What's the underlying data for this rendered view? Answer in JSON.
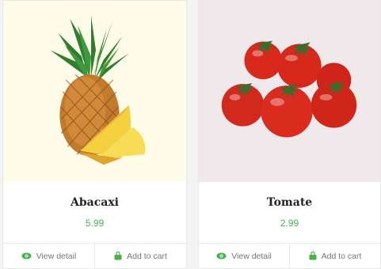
{
  "products": [
    {
      "name": "Abacaxi",
      "price": "5.99",
      "view_label": "View detail",
      "cart_label": "Add to cart",
      "image_icon": "pineapple-image"
    },
    {
      "name": "Tomate",
      "price": "2.99",
      "view_label": "View detail",
      "cart_label": "Add to cart",
      "image_icon": "tomatoes-image"
    }
  ],
  "colors": {
    "accent": "#46b34a",
    "pineapple_bg": "#fffbe9",
    "tomato_bg": "#efe9ec"
  }
}
